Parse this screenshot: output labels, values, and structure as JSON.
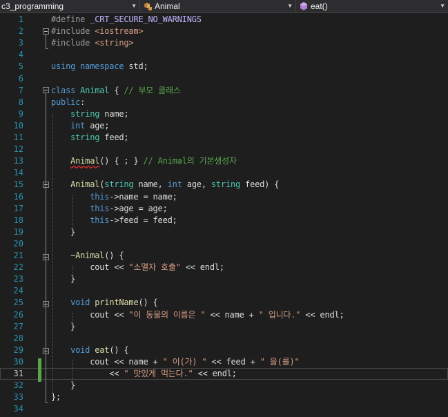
{
  "nav": {
    "project": "c3_programming",
    "scope": "Animal",
    "member": "eat()"
  },
  "lines": [
    {
      "n": "1",
      "tokens": [
        [
          "p",
          "#define "
        ],
        [
          "m",
          "_CRT_SECURE_NO_WARNINGS"
        ]
      ]
    },
    {
      "n": "2",
      "tokens": [
        [
          "p",
          "#include "
        ],
        [
          "s",
          "<iostream>"
        ]
      ]
    },
    {
      "n": "3",
      "tokens": [
        [
          "p",
          "#include "
        ],
        [
          "s",
          "<string>"
        ]
      ]
    },
    {
      "n": "4",
      "tokens": []
    },
    {
      "n": "5",
      "tokens": [
        [
          "k",
          "using"
        ],
        [
          "v",
          " "
        ],
        [
          "k",
          "namespace"
        ],
        [
          "v",
          " std;"
        ]
      ]
    },
    {
      "n": "6",
      "tokens": []
    },
    {
      "n": "7",
      "tokens": [
        [
          "k",
          "class"
        ],
        [
          "v",
          " "
        ],
        [
          "t",
          "Animal"
        ],
        [
          "v",
          " { "
        ],
        [
          "c",
          "// 부모 클래스"
        ]
      ]
    },
    {
      "n": "8",
      "tokens": [
        [
          "k",
          "public"
        ],
        [
          "v",
          ":"
        ]
      ]
    },
    {
      "n": "9",
      "tokens": [
        [
          "v",
          "    "
        ],
        [
          "t",
          "string"
        ],
        [
          "v",
          " name;"
        ]
      ]
    },
    {
      "n": "10",
      "tokens": [
        [
          "v",
          "    "
        ],
        [
          "k",
          "int"
        ],
        [
          "v",
          " age;"
        ]
      ]
    },
    {
      "n": "11",
      "tokens": [
        [
          "v",
          "    "
        ],
        [
          "t",
          "string"
        ],
        [
          "v",
          " feed;"
        ]
      ]
    },
    {
      "n": "12",
      "tokens": []
    },
    {
      "n": "13",
      "tokens": [
        [
          "v",
          "    "
        ],
        [
          "f sq",
          "Animal"
        ],
        [
          "v",
          "() { ; } "
        ],
        [
          "c",
          "// Animal의 기본생성자"
        ]
      ]
    },
    {
      "n": "14",
      "tokens": []
    },
    {
      "n": "15",
      "tokens": [
        [
          "v",
          "    "
        ],
        [
          "f",
          "Animal"
        ],
        [
          "v",
          "("
        ],
        [
          "t",
          "string"
        ],
        [
          "v",
          " name, "
        ],
        [
          "k",
          "int"
        ],
        [
          "v",
          " age, "
        ],
        [
          "t",
          "string"
        ],
        [
          "v",
          " feed) {"
        ]
      ]
    },
    {
      "n": "16",
      "tokens": [
        [
          "v",
          "        "
        ],
        [
          "k",
          "this"
        ],
        [
          "v",
          "->name = name;"
        ]
      ]
    },
    {
      "n": "17",
      "tokens": [
        [
          "v",
          "        "
        ],
        [
          "k",
          "this"
        ],
        [
          "v",
          "->age = age;"
        ]
      ]
    },
    {
      "n": "18",
      "tokens": [
        [
          "v",
          "        "
        ],
        [
          "k",
          "this"
        ],
        [
          "v",
          "->feed = feed;"
        ]
      ]
    },
    {
      "n": "19",
      "tokens": [
        [
          "v",
          "    }"
        ]
      ]
    },
    {
      "n": "20",
      "tokens": []
    },
    {
      "n": "21",
      "tokens": [
        [
          "v",
          "    ~"
        ],
        [
          "f",
          "Animal"
        ],
        [
          "v",
          "() {"
        ]
      ]
    },
    {
      "n": "22",
      "tokens": [
        [
          "v",
          "        cout << "
        ],
        [
          "s",
          "\"소멸자 호출\""
        ],
        [
          "v",
          " << endl;"
        ]
      ]
    },
    {
      "n": "23",
      "tokens": [
        [
          "v",
          "    }"
        ]
      ]
    },
    {
      "n": "24",
      "tokens": []
    },
    {
      "n": "25",
      "tokens": [
        [
          "v",
          "    "
        ],
        [
          "k",
          "void"
        ],
        [
          "v",
          " "
        ],
        [
          "f",
          "printName"
        ],
        [
          "v",
          "() {"
        ]
      ]
    },
    {
      "n": "26",
      "tokens": [
        [
          "v",
          "        cout << "
        ],
        [
          "s",
          "\"이 동물의 이름은 \""
        ],
        [
          "v",
          " << name + "
        ],
        [
          "s",
          "\" 입니다.\""
        ],
        [
          "v",
          " << endl;"
        ]
      ]
    },
    {
      "n": "27",
      "tokens": [
        [
          "v",
          "    }"
        ]
      ]
    },
    {
      "n": "28",
      "tokens": []
    },
    {
      "n": "29",
      "tokens": [
        [
          "v",
          "    "
        ],
        [
          "k",
          "void"
        ],
        [
          "v",
          " "
        ],
        [
          "f",
          "eat"
        ],
        [
          "v",
          "() {"
        ]
      ]
    },
    {
      "n": "30",
      "tokens": [
        [
          "v",
          "        cout << name + "
        ],
        [
          "s",
          "\" 이(가) \""
        ],
        [
          "v",
          " << feed + "
        ],
        [
          "s",
          "\" 을(를)\""
        ]
      ]
    },
    {
      "n": "31",
      "tokens": [
        [
          "v",
          "            << "
        ],
        [
          "s",
          "\" 맛있게 먹는다.\""
        ],
        [
          "v",
          " << endl;"
        ]
      ]
    },
    {
      "n": "32",
      "tokens": [
        [
          "v",
          "    }"
        ]
      ]
    },
    {
      "n": "33",
      "tokens": [
        [
          "v",
          "};"
        ]
      ]
    },
    {
      "n": "34",
      "tokens": []
    }
  ]
}
